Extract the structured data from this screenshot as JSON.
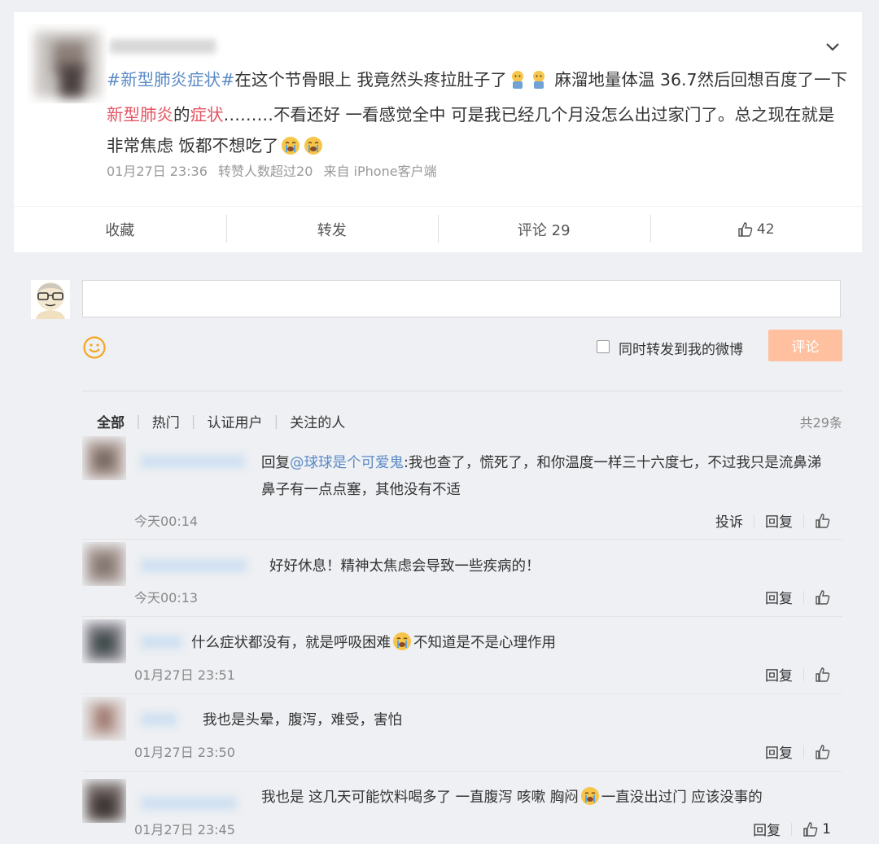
{
  "post": {
    "topic": "#新型肺炎症状#",
    "text_1": "在这个节骨眼上 我竟然头疼拉肚子了",
    "emoji_1": "sick-emoji",
    "text_2": "麻溜地量体温 36.7然后回想百度了一下",
    "highlight_1": "新型肺炎",
    "text_3": "的",
    "highlight_2": "症状",
    "text_4": "………不看还好 一看感觉全中 可是我已经几个月没怎么出过家门了。总之现在就是非常焦虑 饭都不想吃了",
    "emoji_2": "crying-emoji",
    "time": "01月27日 23:36",
    "repost_note": "转赞人数超过20",
    "source": "来自 iPhone客户端"
  },
  "actions": {
    "favorite": "收藏",
    "repost": "转发",
    "comment": "评论 29",
    "like_count": "42"
  },
  "composer": {
    "forward_label": "同时转发到我的微博",
    "submit": "评论"
  },
  "filters": {
    "all": "全部",
    "hot": "热门",
    "verified": "认证用户",
    "following": "关注的人",
    "total": "共29条"
  },
  "comments": [
    {
      "reply_prefix": "回复",
      "mention": "@球球是个可爱鬼",
      "text": ":我也查了，慌死了，和你温度一样三十六度七，不过我只是流鼻涕鼻子有一点点塞，其他没有不适",
      "time": "今天00:14",
      "report": "投诉",
      "reply": "回复"
    },
    {
      "text": "好好休息！精神太焦虑会导致一些疾病的！",
      "time": "今天00:13",
      "reply": "回复"
    },
    {
      "text_before": "什么症状都没有，就是呼吸困难",
      "emoji": "crying-emoji",
      "text_after": "不知道是不是心理作用",
      "time": "01月27日 23:51",
      "reply": "回复"
    },
    {
      "text": "我也是头晕，腹泻，难受，害怕",
      "time": "01月27日 23:50",
      "reply": "回复"
    },
    {
      "text_before": "我也是 这几天可能饮料喝多了 一直腹泻 咳嗽 胸闷",
      "emoji": "crying-emoji",
      "text_after": "一直没出过门 应该没事的",
      "time": "01月27日 23:45",
      "reply": "回复",
      "likes": "1"
    }
  ],
  "colors": {
    "topic": "#5a8ac6",
    "highlight": "#e45361",
    "submit_button": "#ffc09f",
    "smile_icon": "#f5a623"
  }
}
